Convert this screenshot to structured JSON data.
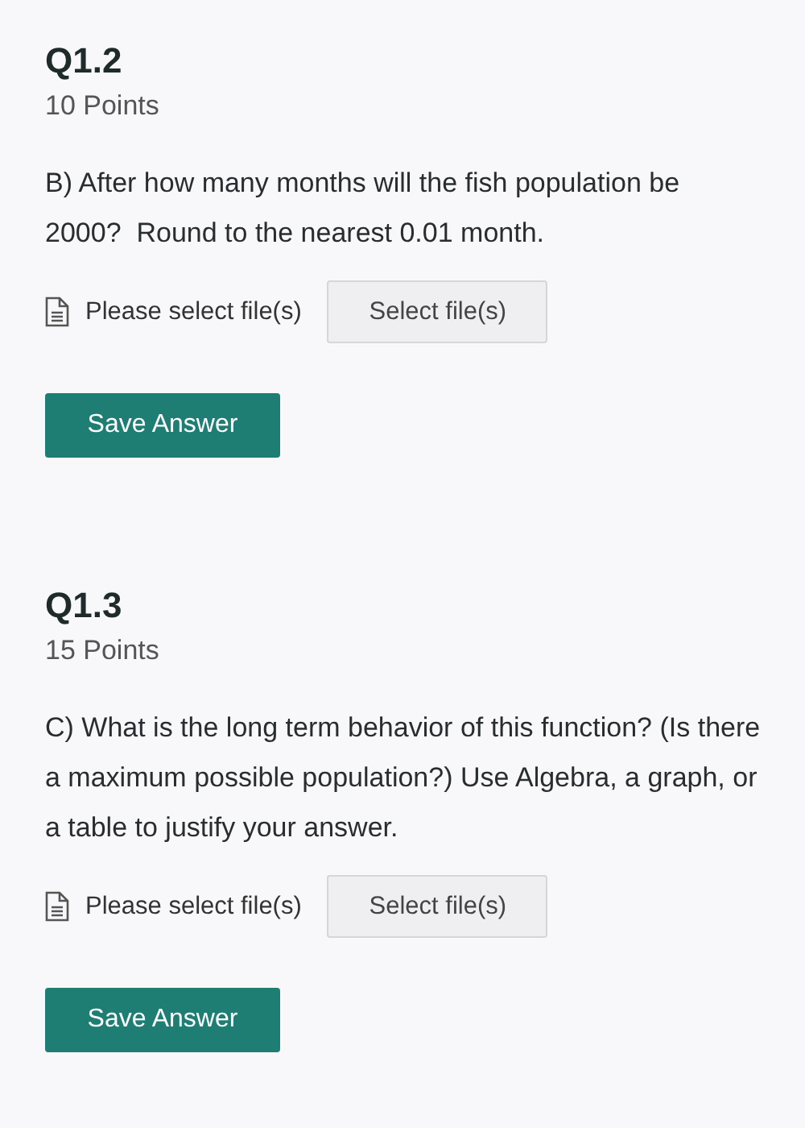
{
  "questions": [
    {
      "title": "Q1.2",
      "points": "10 Points",
      "prompt": "B) After how many months will the fish population be 2000?  Round to the nearest 0.01 month.",
      "file_status": "Please select file(s)",
      "select_button": "Select file(s)",
      "save_button": "Save Answer"
    },
    {
      "title": "Q1.3",
      "points": "15 Points",
      "prompt": "C) What is the long term behavior of this function? (Is there a maximum possible population?) Use Algebra, a graph, or a table to justify your answer.",
      "file_status": "Please select file(s)",
      "select_button": "Select file(s)",
      "save_button": "Save Answer"
    }
  ]
}
